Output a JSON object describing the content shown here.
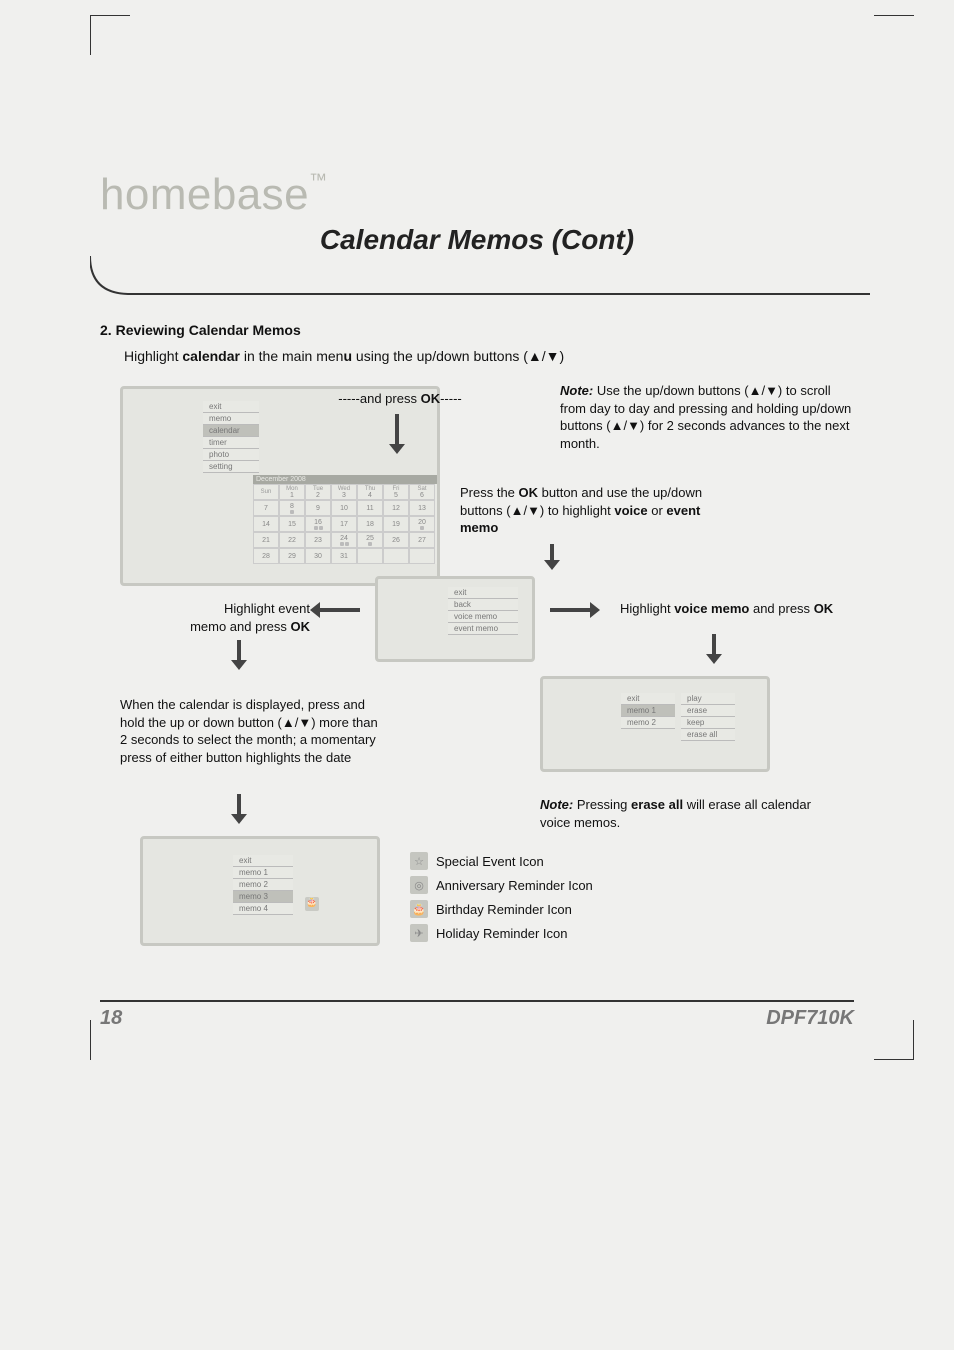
{
  "brand": "homebase",
  "title": "Calendar Memos (Cont)",
  "section_number": "2.",
  "section_title": "Reviewing Calendar Memos",
  "intro_pre": "Highlight ",
  "intro_bold1": "calendar",
  "intro_mid": " in the main men",
  "intro_bold2": "u",
  "intro_post": " using the up/down buttons (▲/▼)",
  "flow": {
    "and_press": "-----and press ",
    "ok": "OK",
    "dash_tail": "-----",
    "press_ok_use_pre": "Press the ",
    "press_ok_use_mid": " button and use  the up/down buttons (▲/▼) to highlight ",
    "voice": "voice",
    "or": " or ",
    "event_memo": "event memo",
    "highlight_event_1": "Highlight event",
    "highlight_event_2": "memo and press ",
    "highlight_voice_1": "Highlight ",
    "highlight_voice_b": "voice memo",
    "highlight_voice_2": " and press ",
    "calendar_displayed": "When the calendar is displayed, press and hold the up or down button (▲/▼) more than 2 seconds to select the month; a momentary press of either button highlights the date"
  },
  "note1_label": "Note:",
  "note1_text": " Use the up/down buttons (▲/▼) to scroll from day to day and pressing and holding up/down buttons (▲/▼) for 2 seconds advances to the next month.",
  "note2_label": "Note:",
  "note2_pre": " Pressing ",
  "note2_bold": "erase all",
  "note2_post": " will erase all calendar voice memos.",
  "screens": {
    "main": {
      "items": [
        "exit",
        "memo",
        "calendar",
        "timer",
        "photo",
        "setting"
      ],
      "hl_index": 2,
      "calendar_title": "December 2008",
      "day_headers": [
        "Sun",
        "Mon",
        "Tue",
        "Wed",
        "Thu",
        "Fri",
        "Sat"
      ],
      "nums": [
        [
          " ",
          "1",
          "2",
          "3",
          "4",
          "5",
          "6"
        ],
        [
          "7",
          "8",
          "9",
          "10",
          "11",
          "12",
          "13"
        ],
        [
          "14",
          "15",
          "16",
          "17",
          "18",
          "19",
          "20"
        ],
        [
          "21",
          "22",
          "23",
          "24",
          "25",
          "26",
          "27"
        ],
        [
          "28",
          "29",
          "30",
          "31",
          " ",
          " ",
          " "
        ]
      ]
    },
    "memo_type": {
      "items": [
        "exit",
        "back",
        "voice memo",
        "event memo"
      ]
    },
    "voice_list": {
      "left": [
        "exit",
        "memo 1",
        "memo 2"
      ],
      "right": [
        "play",
        "erase",
        "keep",
        "erase all"
      ],
      "hl_left": 1
    },
    "event_list": {
      "items": [
        "exit",
        "memo 1",
        "memo 2",
        "memo 3",
        "memo 4"
      ],
      "hl_index": 3
    }
  },
  "icons": {
    "legend": [
      {
        "name": "star-icon",
        "label": "Special Event Icon"
      },
      {
        "name": "ring-icon",
        "label": "Anniversary Reminder Icon"
      },
      {
        "name": "cake-icon",
        "label": "Birthday Reminder Icon"
      },
      {
        "name": "plane-icon",
        "label": "Holiday Reminder Icon"
      }
    ]
  },
  "footer": {
    "page": "18",
    "model": "DPF710K"
  }
}
